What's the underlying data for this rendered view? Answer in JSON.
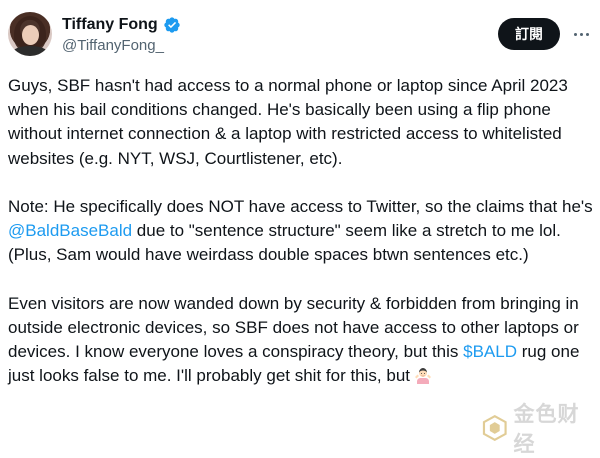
{
  "author": {
    "name": "Tiffany Fong",
    "handle": "@TiffanyFong_",
    "verified": true,
    "avatar_icon": "profile-photo"
  },
  "actions": {
    "follow_label": "訂閱",
    "more_icon": "more-horizontal-icon"
  },
  "tweet": {
    "p1": "Guys, SBF hasn't had access to a normal phone or laptop since April 2023 when his bail conditions changed. He's basically been using a flip phone without internet connection & a laptop with restricted access to whitelisted websites (e.g. NYT, WSJ, Courtlistener, etc).",
    "p2_before": "Note: He specifically does NOT have access to Twitter, so the claims that he's ",
    "p2_mention": "@BaldBaseBald",
    "p2_after": " due to \"sentence structure\" seem like a stretch to me lol. (Plus, Sam would have weirdass double spaces btwn sentences etc.)",
    "p3_before": "Even visitors are now wanded down by security & forbidden from bringing in outside electronic devices, so SBF does not have access to other laptops or devices. I know everyone loves a conspiracy theory, but this ",
    "p3_cashtag": "$BALD",
    "p3_after": " rug one just looks false to me. I'll probably get shit for this, but",
    "p3_emoji": "person-shrugging-emoji"
  },
  "watermark": {
    "text": "金色财经"
  },
  "colors": {
    "link": "#1d9bf0",
    "text": "#0f1419",
    "secondary": "#536471",
    "verified": "#1d9bf0",
    "button": "#0f1419"
  }
}
